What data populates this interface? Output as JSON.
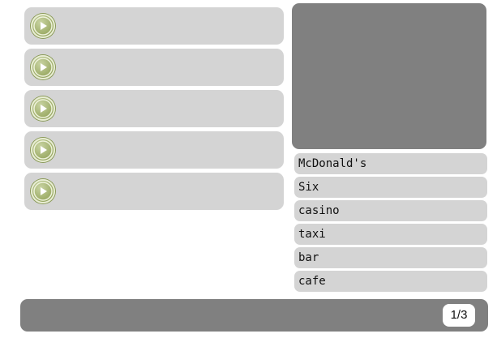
{
  "audio_clips": {
    "count": 5,
    "icon": "play-icon"
  },
  "image_panel": {
    "color": "#808080"
  },
  "choices": [
    {
      "label": "McDonald's"
    },
    {
      "label": "Six"
    },
    {
      "label": "casino"
    },
    {
      "label": "taxi"
    },
    {
      "label": "bar"
    },
    {
      "label": "cafe"
    }
  ],
  "footer": {
    "page_counter": "1/3"
  },
  "colors": {
    "row_bg": "#d4d4d4",
    "panel_bg": "#808080",
    "play_accent": "#9fae6a"
  }
}
